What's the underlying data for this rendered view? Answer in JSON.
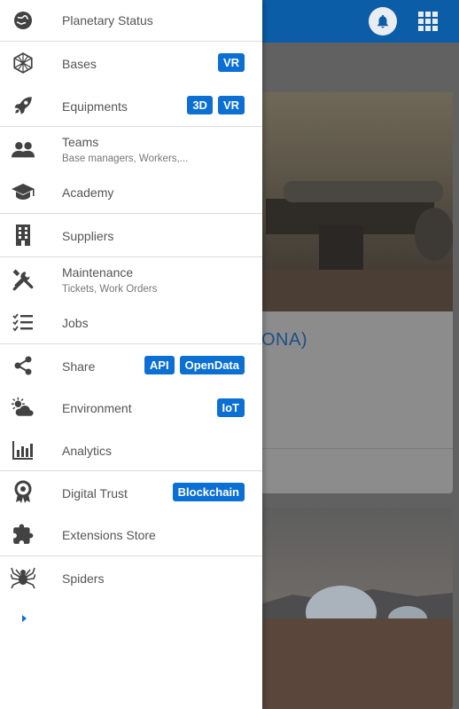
{
  "colors": {
    "topbar": "#0b5da7",
    "badge": "#0b6fd3",
    "icon": "#424242",
    "label": "#555555",
    "drawer_bg": "#ffffff"
  },
  "background": {
    "card_title_fragment": "ONA)"
  },
  "drawer": {
    "items": [
      {
        "label": "Planetary Status",
        "icon": "planet-icon",
        "badges": []
      },
      {
        "label": "Bases",
        "icon": "geodesic-dome-icon",
        "badges": [
          "VR"
        ]
      },
      {
        "label": "Equipments",
        "icon": "rocket-icon",
        "badges": [
          "3D",
          "VR"
        ]
      },
      {
        "label": "Teams",
        "sub": "Base managers, Workers,...",
        "icon": "people-icon",
        "badges": []
      },
      {
        "label": "Academy",
        "icon": "graduation-cap-icon",
        "badges": []
      },
      {
        "label": "Suppliers",
        "icon": "building-icon",
        "badges": []
      },
      {
        "label": "Maintenance",
        "sub": "Tickets, Work Orders",
        "icon": "tools-icon",
        "badges": []
      },
      {
        "label": "Jobs",
        "icon": "checklist-icon",
        "badges": []
      },
      {
        "label": "Share",
        "icon": "share-icon",
        "badges": [
          "API",
          "OpenData"
        ]
      },
      {
        "label": "Environment",
        "icon": "weather-icon",
        "badges": [
          "IoT"
        ]
      },
      {
        "label": "Analytics",
        "icon": "bar-chart-icon",
        "badges": []
      },
      {
        "label": "Digital Trust",
        "icon": "award-ribbon-icon",
        "badges": [
          "Blockchain"
        ]
      },
      {
        "label": "Extensions Store",
        "icon": "puzzle-icon",
        "badges": []
      },
      {
        "label": "Spiders",
        "icon": "spider-icon",
        "badges": []
      }
    ]
  },
  "topbar": {
    "icons": [
      "bell-icon",
      "apps-grid-icon"
    ]
  }
}
